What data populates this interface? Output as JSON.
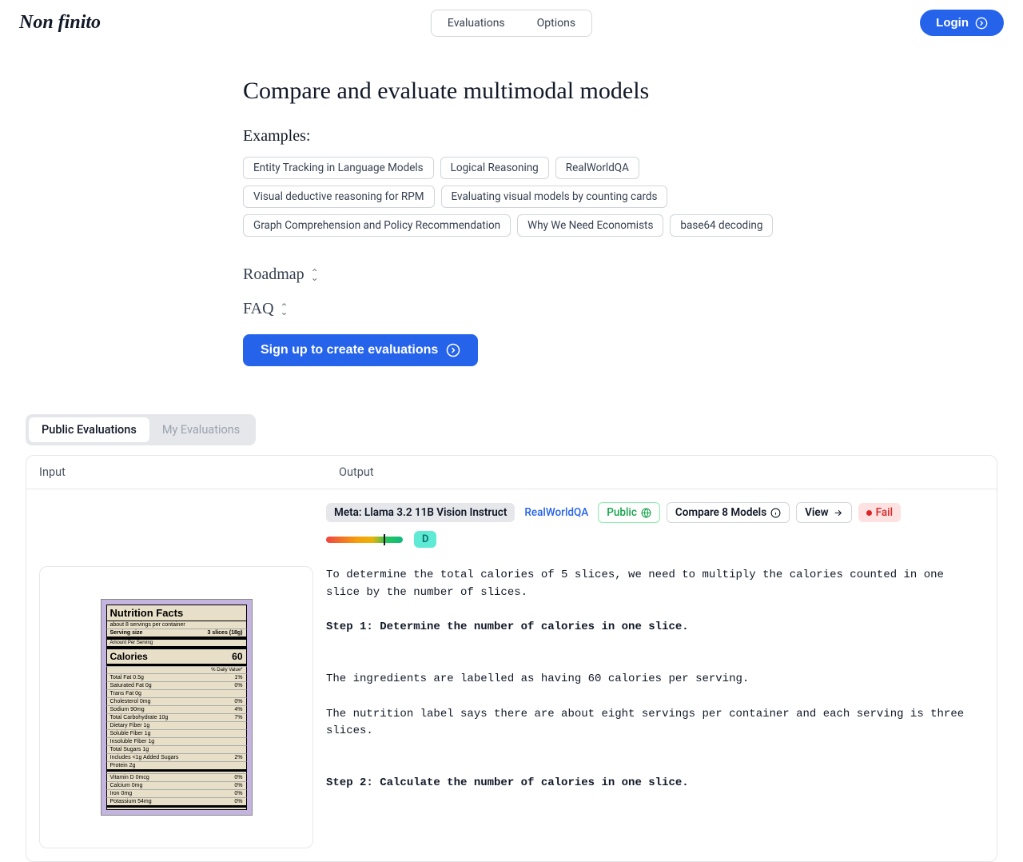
{
  "brand": "Non finito",
  "nav": {
    "evaluations": "Evaluations",
    "options": "Options"
  },
  "login": "Login",
  "hero": {
    "title": "Compare and evaluate multimodal models",
    "examples_label": "Examples:",
    "examples": [
      "Entity Tracking in Language Models",
      "Logical Reasoning",
      "RealWorldQA",
      "Visual deductive reasoning for RPM",
      "Evaluating visual models by counting cards",
      "Graph Comprehension and Policy Recommendation",
      "Why We Need Economists",
      "base64 decoding"
    ],
    "roadmap": "Roadmap",
    "faq": "FAQ",
    "signup": "Sign up to create evaluations"
  },
  "tabs": {
    "public": "Public Evaluations",
    "mine": "My Evaluations"
  },
  "eval": {
    "columns": {
      "input": "Input",
      "output": "Output"
    },
    "model": "Meta: Llama 3.2 11B Vision Instruct",
    "dataset": "RealWorldQA",
    "public": "Public",
    "compare": "Compare 8 Models",
    "view": "View",
    "status": "Fail",
    "grade": "D",
    "output_intro": "To determine the total calories of 5 slices, we need to multiply the calories counted in one slice by the number of slices.",
    "output_step1_title": "Step 1: Determine the number of calories in one slice.",
    "output_line1": "The ingredients are labelled as having 60 calories per serving.",
    "output_line2": "The nutrition label says there are about eight servings per container and each serving is three slices.",
    "output_step2_title": "Step 2: Calculate the number of calories in one slice.",
    "nutrition": {
      "title": "Nutrition Facts",
      "servings": "about 8 servings per container",
      "serving_size_label": "Serving size",
      "serving_size_value": "3 slices (18g)",
      "amount_label": "Amount Per Serving",
      "calories_label": "Calories",
      "calories_value": "60",
      "dv_label": "% Daily Value*",
      "rows": [
        {
          "l": "Total Fat 0.5g",
          "r": "1%"
        },
        {
          "l": "  Saturated Fat 0g",
          "r": "0%"
        },
        {
          "l": "  Trans Fat 0g",
          "r": ""
        },
        {
          "l": "Cholesterol 0mg",
          "r": "0%"
        },
        {
          "l": "Sodium 90mg",
          "r": "4%"
        },
        {
          "l": "Total Carbohydrate 10g",
          "r": "7%"
        },
        {
          "l": "  Dietary Fiber 1g",
          "r": ""
        },
        {
          "l": "  Soluble Fiber 1g",
          "r": ""
        },
        {
          "l": "  Insoluble Fiber 1g",
          "r": ""
        },
        {
          "l": "  Total Sugars 1g",
          "r": ""
        },
        {
          "l": "    Includes <1g Added Sugars",
          "r": "2%"
        },
        {
          "l": "Protein 2g",
          "r": ""
        }
      ],
      "vitamins": [
        {
          "l": "Vitamin D 0mcg",
          "r": "0%"
        },
        {
          "l": "Calcium 0mg",
          "r": "0%"
        },
        {
          "l": "Iron 0mg",
          "r": "0%"
        },
        {
          "l": "Potassium 54mg",
          "r": "0%"
        }
      ]
    }
  }
}
